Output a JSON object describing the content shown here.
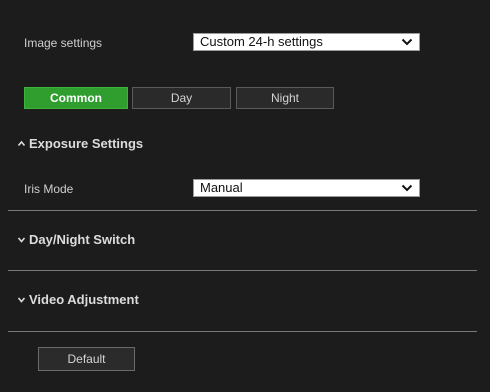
{
  "image_settings": {
    "label": "Image settings",
    "selected": "Custom 24-h settings"
  },
  "tabs": [
    {
      "label": "Common",
      "active": true
    },
    {
      "label": "Day",
      "active": false
    },
    {
      "label": "Night",
      "active": false
    }
  ],
  "sections": {
    "exposure": {
      "title": "Exposure Settings",
      "expanded": true
    },
    "day_night": {
      "title": "Day/Night Switch",
      "expanded": false
    },
    "video": {
      "title": "Video Adjustment",
      "expanded": false
    }
  },
  "iris_mode": {
    "label": "Iris Mode",
    "selected": "Manual"
  },
  "default_button": {
    "label": "Default"
  },
  "colors": {
    "background": "#1c1c1c",
    "active_tab": "#2f9e2f",
    "divider": "#7a7a7a"
  }
}
